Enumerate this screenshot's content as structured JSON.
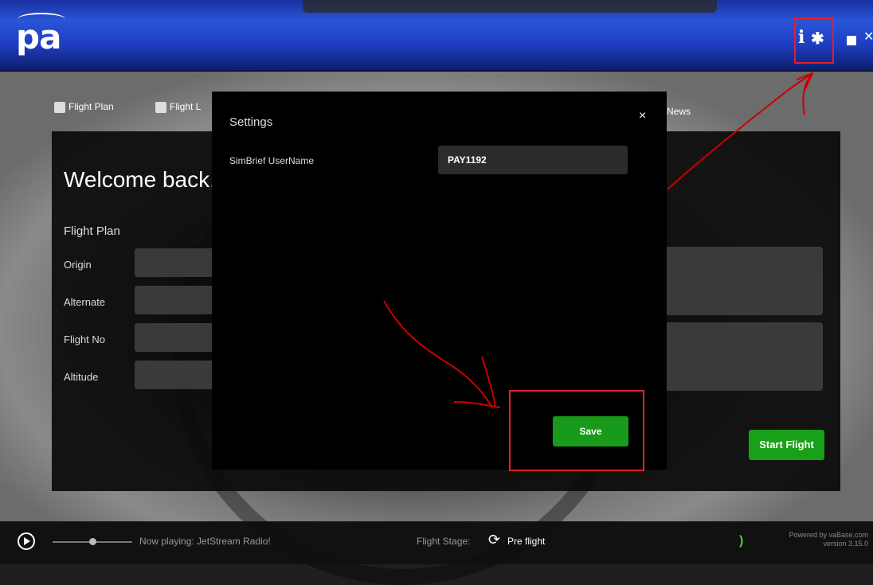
{
  "app": {
    "logo": "pa"
  },
  "titlebar": {
    "info_icon": "info-icon",
    "settings_icon": "gear-icon",
    "minimize_icon": "minimize-icon",
    "close_glyph": "✕"
  },
  "tabs": [
    {
      "label": "Flight Plan",
      "icon": "suitcase-icon"
    },
    {
      "label": "Flight L",
      "icon": "clipboard-icon"
    },
    {
      "label": "News"
    }
  ],
  "main": {
    "welcome": "Welcome back,",
    "section_title": "Flight Plan",
    "fields": [
      {
        "label": "Origin"
      },
      {
        "label": "Alternate"
      },
      {
        "label": "Flight No"
      },
      {
        "label": "Altitude"
      }
    ],
    "start_button": "Start Flight"
  },
  "modal": {
    "title": "Settings",
    "close_glyph": "×",
    "simbrief_label": "SimBrief UserName",
    "simbrief_value": "PAY1192",
    "save_button": "Save"
  },
  "bottombar": {
    "now_playing": "Now playing: JetStream Radio!",
    "stage_label": "Flight Stage:",
    "stage_value": "Pre flight",
    "powered_line1": "Powered by vaBase.com",
    "powered_line2": "version 3.15.0"
  },
  "colors": {
    "accent_green": "#1a9a1a",
    "annotation_red": "#e0202a",
    "titlebar_blue": "#2a55d8"
  }
}
